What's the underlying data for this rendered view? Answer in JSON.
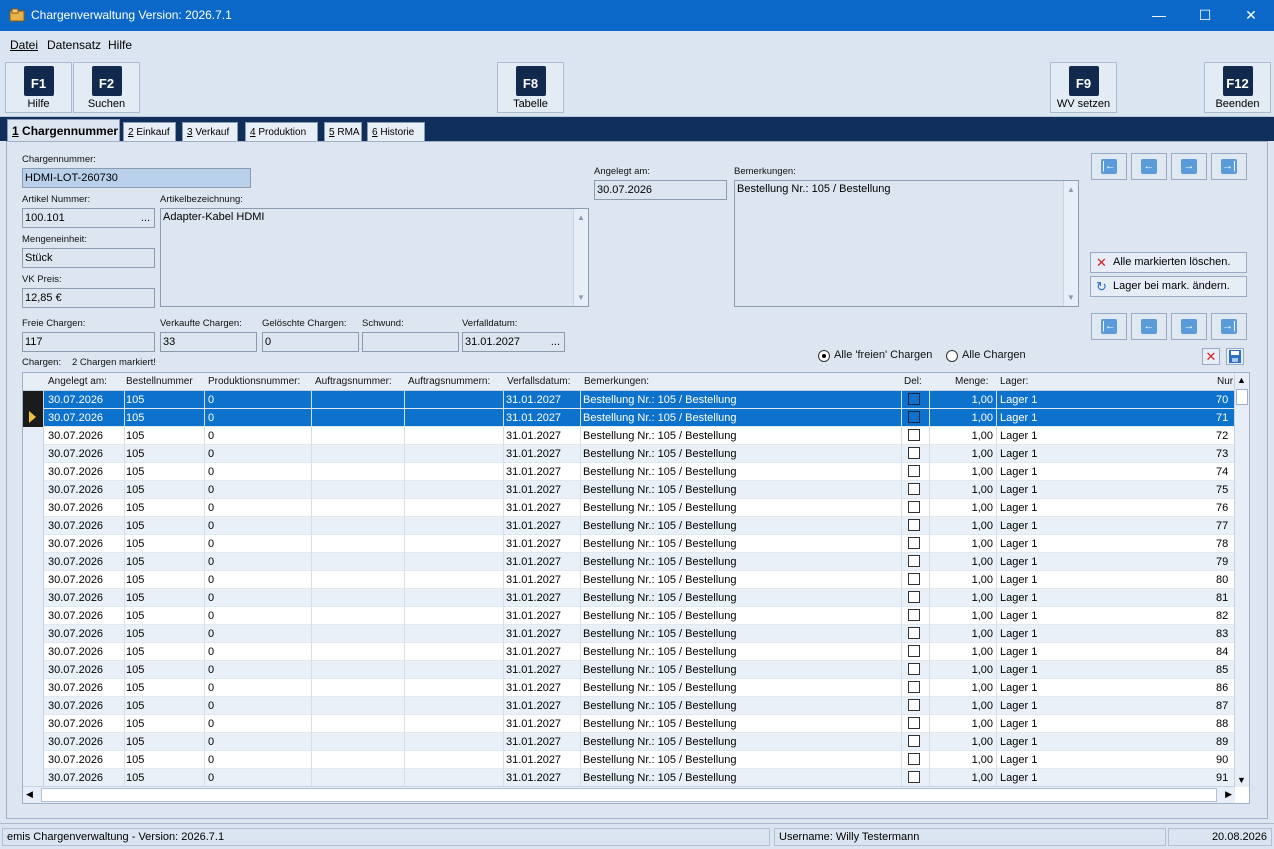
{
  "window": {
    "title": "Chargenverwaltung Version: 2026.7.1",
    "minimize": "—",
    "maximize": "☐",
    "close": "✕"
  },
  "menu": {
    "datei": "Datei",
    "datensatz": "Datensatz",
    "hilfe": "Hilfe"
  },
  "toolbar": {
    "f1": {
      "key": "F1",
      "label": "Hilfe"
    },
    "f2": {
      "key": "F2",
      "label": "Suchen"
    },
    "f8": {
      "key": "F8",
      "label": "Tabelle"
    },
    "f9": {
      "key": "F9",
      "label": "WV setzen"
    },
    "f12": {
      "key": "F12",
      "label": "Beenden"
    }
  },
  "tabs": [
    {
      "num": "1",
      "label": "Chargennummer"
    },
    {
      "num": "2",
      "label": "Einkauf"
    },
    {
      "num": "3",
      "label": "Verkauf"
    },
    {
      "num": "4",
      "label": "Produktion"
    },
    {
      "num": "5",
      "label": "RMA"
    },
    {
      "num": "6",
      "label": "Historie"
    }
  ],
  "form": {
    "chargennummer_label": "Chargennummer:",
    "chargennummer": "HDMI-LOT-260730",
    "artikelnummer_label": "Artikel Nummer:",
    "artikelnummer": "100.101",
    "artikelbez_label": "Artikelbezeichnung:",
    "artikelbez": "Adapter-Kabel HDMI",
    "mengeneinheit_label": "Mengeneinheit:",
    "mengeneinheit": "Stück",
    "vkpreis_label": "VK Preis:",
    "vkpreis": "12,85 €",
    "angelegt_label": "Angelegt am:",
    "angelegt": "30.07.2026",
    "bemerkungen_label": "Bemerkungen:",
    "bemerkungen": "Bestellung Nr.: 105 / Bestellung",
    "freie_label": "Freie Chargen:",
    "freie": "117",
    "verkaufte_label": "Verkaufte Chargen:",
    "verkaufte": "33",
    "geloeschte_label": "Gelöschte Chargen:",
    "geloeschte": "0",
    "schwund_label": "Schwund:",
    "schwund": "",
    "verfall_label": "Verfalldatum:",
    "verfall": "31.01.2027",
    "ellipsis": "..."
  },
  "actions": {
    "delete_marked": "Alle markierten löschen.",
    "change_lager": "Lager bei mark. ändern."
  },
  "filter": {
    "freie": "Alle 'freien' Chargen",
    "alle": "Alle Chargen",
    "selected": "freie"
  },
  "chargen_info": {
    "label": "Chargen:",
    "marked": "2 Chargen markiert!"
  },
  "table": {
    "headers": [
      "Angelegt am:",
      "Bestellnummer",
      "Produktionsnummer:",
      "Auftragsnummer:",
      "Auftragsnummern:",
      "Verfallsdatum:",
      "Bemerkungen:",
      "Del:",
      "Menge:",
      "Lager:",
      "Nur"
    ],
    "rows": [
      {
        "angelegt": "30.07.2026",
        "bestell": "105",
        "prod": "0",
        "verfall": "31.01.2027",
        "bem": "Bestellung Nr.: 105 / Bestellung",
        "menge": "1,00",
        "lager": "Lager 1",
        "nr": "70",
        "selected": true
      },
      {
        "angelegt": "30.07.2026",
        "bestell": "105",
        "prod": "0",
        "verfall": "31.01.2027",
        "bem": "Bestellung Nr.: 105 / Bestellung",
        "menge": "1,00",
        "lager": "Lager 1",
        "nr": "71",
        "selected": true,
        "current": true
      },
      {
        "angelegt": "30.07.2026",
        "bestell": "105",
        "prod": "0",
        "verfall": "31.01.2027",
        "bem": "Bestellung Nr.: 105 / Bestellung",
        "menge": "1,00",
        "lager": "Lager 1",
        "nr": "72"
      },
      {
        "angelegt": "30.07.2026",
        "bestell": "105",
        "prod": "0",
        "verfall": "31.01.2027",
        "bem": "Bestellung Nr.: 105 / Bestellung",
        "menge": "1,00",
        "lager": "Lager 1",
        "nr": "73"
      },
      {
        "angelegt": "30.07.2026",
        "bestell": "105",
        "prod": "0",
        "verfall": "31.01.2027",
        "bem": "Bestellung Nr.: 105 / Bestellung",
        "menge": "1,00",
        "lager": "Lager 1",
        "nr": "74"
      },
      {
        "angelegt": "30.07.2026",
        "bestell": "105",
        "prod": "0",
        "verfall": "31.01.2027",
        "bem": "Bestellung Nr.: 105 / Bestellung",
        "menge": "1,00",
        "lager": "Lager 1",
        "nr": "75"
      },
      {
        "angelegt": "30.07.2026",
        "bestell": "105",
        "prod": "0",
        "verfall": "31.01.2027",
        "bem": "Bestellung Nr.: 105 / Bestellung",
        "menge": "1,00",
        "lager": "Lager 1",
        "nr": "76"
      },
      {
        "angelegt": "30.07.2026",
        "bestell": "105",
        "prod": "0",
        "verfall": "31.01.2027",
        "bem": "Bestellung Nr.: 105 / Bestellung",
        "menge": "1,00",
        "lager": "Lager 1",
        "nr": "77"
      },
      {
        "angelegt": "30.07.2026",
        "bestell": "105",
        "prod": "0",
        "verfall": "31.01.2027",
        "bem": "Bestellung Nr.: 105 / Bestellung",
        "menge": "1,00",
        "lager": "Lager 1",
        "nr": "78"
      },
      {
        "angelegt": "30.07.2026",
        "bestell": "105",
        "prod": "0",
        "verfall": "31.01.2027",
        "bem": "Bestellung Nr.: 105 / Bestellung",
        "menge": "1,00",
        "lager": "Lager 1",
        "nr": "79"
      },
      {
        "angelegt": "30.07.2026",
        "bestell": "105",
        "prod": "0",
        "verfall": "31.01.2027",
        "bem": "Bestellung Nr.: 105 / Bestellung",
        "menge": "1,00",
        "lager": "Lager 1",
        "nr": "80"
      },
      {
        "angelegt": "30.07.2026",
        "bestell": "105",
        "prod": "0",
        "verfall": "31.01.2027",
        "bem": "Bestellung Nr.: 105 / Bestellung",
        "menge": "1,00",
        "lager": "Lager 1",
        "nr": "81"
      },
      {
        "angelegt": "30.07.2026",
        "bestell": "105",
        "prod": "0",
        "verfall": "31.01.2027",
        "bem": "Bestellung Nr.: 105 / Bestellung",
        "menge": "1,00",
        "lager": "Lager 1",
        "nr": "82"
      },
      {
        "angelegt": "30.07.2026",
        "bestell": "105",
        "prod": "0",
        "verfall": "31.01.2027",
        "bem": "Bestellung Nr.: 105 / Bestellung",
        "menge": "1,00",
        "lager": "Lager 1",
        "nr": "83"
      },
      {
        "angelegt": "30.07.2026",
        "bestell": "105",
        "prod": "0",
        "verfall": "31.01.2027",
        "bem": "Bestellung Nr.: 105 / Bestellung",
        "menge": "1,00",
        "lager": "Lager 1",
        "nr": "84"
      },
      {
        "angelegt": "30.07.2026",
        "bestell": "105",
        "prod": "0",
        "verfall": "31.01.2027",
        "bem": "Bestellung Nr.: 105 / Bestellung",
        "menge": "1,00",
        "lager": "Lager 1",
        "nr": "85"
      },
      {
        "angelegt": "30.07.2026",
        "bestell": "105",
        "prod": "0",
        "verfall": "31.01.2027",
        "bem": "Bestellung Nr.: 105 / Bestellung",
        "menge": "1,00",
        "lager": "Lager 1",
        "nr": "86"
      },
      {
        "angelegt": "30.07.2026",
        "bestell": "105",
        "prod": "0",
        "verfall": "31.01.2027",
        "bem": "Bestellung Nr.: 105 / Bestellung",
        "menge": "1,00",
        "lager": "Lager 1",
        "nr": "87"
      },
      {
        "angelegt": "30.07.2026",
        "bestell": "105",
        "prod": "0",
        "verfall": "31.01.2027",
        "bem": "Bestellung Nr.: 105 / Bestellung",
        "menge": "1,00",
        "lager": "Lager 1",
        "nr": "88"
      },
      {
        "angelegt": "30.07.2026",
        "bestell": "105",
        "prod": "0",
        "verfall": "31.01.2027",
        "bem": "Bestellung Nr.: 105 / Bestellung",
        "menge": "1,00",
        "lager": "Lager 1",
        "nr": "89"
      },
      {
        "angelegt": "30.07.2026",
        "bestell": "105",
        "prod": "0",
        "verfall": "31.01.2027",
        "bem": "Bestellung Nr.: 105 / Bestellung",
        "menge": "1,00",
        "lager": "Lager 1",
        "nr": "90"
      },
      {
        "angelegt": "30.07.2026",
        "bestell": "105",
        "prod": "0",
        "verfall": "31.01.2027",
        "bem": "Bestellung Nr.: 105 / Bestellung",
        "menge": "1,00",
        "lager": "Lager 1",
        "nr": "91"
      }
    ]
  },
  "status": {
    "app": "emis Chargenverwaltung - Version: 2026.7.1",
    "user": "Username: Willy Testermann",
    "date": "20.08.2026"
  },
  "icons": {
    "app": "folder-icon",
    "nav_first": "first-record-icon",
    "nav_prev": "prev-record-icon",
    "nav_next": "next-record-icon",
    "nav_last": "last-record-icon",
    "delete": "red-x-icon",
    "refresh": "refresh-icon",
    "save": "save-icon"
  },
  "colors": {
    "title_bar": "#0b68c8",
    "tab_band": "#0f2f5a",
    "selection": "#0d72cc",
    "fkey": "#12294e"
  }
}
